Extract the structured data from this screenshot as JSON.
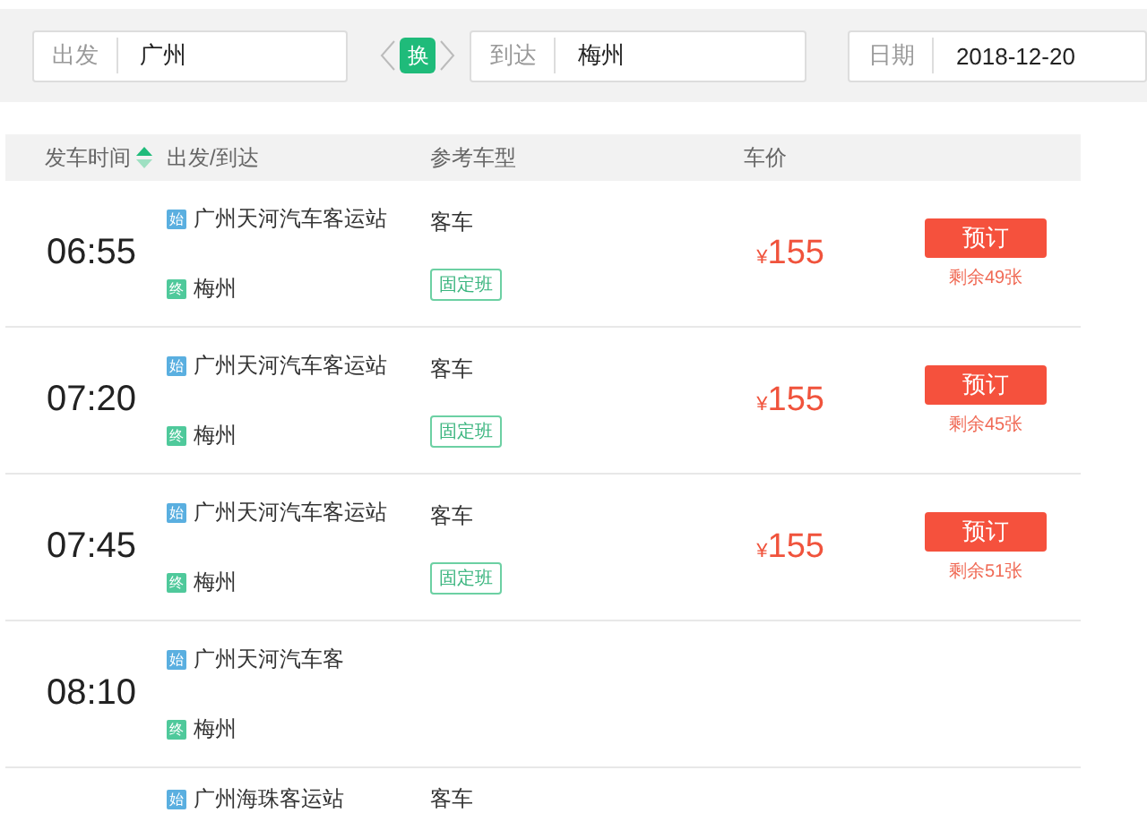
{
  "search": {
    "from": {
      "label": "出发",
      "value": "广州"
    },
    "swap": "换",
    "to": {
      "label": "到达",
      "value": "梅州"
    },
    "date": {
      "label": "日期",
      "value": "2018-12-20"
    }
  },
  "table": {
    "columns": [
      {
        "label": "发车时间",
        "sorted": true
      },
      {
        "label": "出发/到达",
        "sorted": false
      },
      {
        "label": "参考车型",
        "sorted": false
      },
      {
        "label": "车价",
        "sorted": false
      }
    ],
    "rows": [
      {
        "time": "06:55",
        "start_badge": "始",
        "from": "广州天河汽车客运站",
        "end_badge": "终",
        "to": "梅州",
        "type": "客车",
        "tag": "固定班",
        "currency": "¥",
        "price": "155",
        "button": "预订",
        "remaining": "剩余49张"
      },
      {
        "time": "07:20",
        "start_badge": "始",
        "from": "广州天河汽车客运站",
        "end_badge": "终",
        "to": "梅州",
        "type": "客车",
        "tag": "固定班",
        "currency": "¥",
        "price": "155",
        "button": "预订",
        "remaining": "剩余45张"
      },
      {
        "time": "07:45",
        "start_badge": "始",
        "from": "广州天河汽车客运站",
        "end_badge": "终",
        "to": "梅州",
        "type": "客车",
        "tag": "固定班",
        "currency": "¥",
        "price": "155",
        "button": "预订",
        "remaining": "剩余51张"
      },
      {
        "time": "08:10",
        "start_badge": "始",
        "from": "广州天河汽车客",
        "end_badge": "终",
        "to": "梅州"
      },
      {
        "start_badge": "始",
        "from": "广州海珠客运站",
        "type": "客车"
      }
    ]
  }
}
